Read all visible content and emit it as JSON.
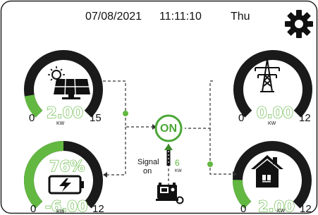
{
  "header": {
    "date": "07/08/2021",
    "time": "11:11:10",
    "day": "Thu"
  },
  "settings": {
    "icon": "gear-icon"
  },
  "pv": {
    "value": "2.00",
    "unit": "KW",
    "scale_min": "0",
    "scale_max": "15",
    "level": 0.13,
    "icon": "solar-panel-icon"
  },
  "grid": {
    "value": "0.00",
    "unit": "KW",
    "scale_min": "0",
    "scale_max": "12",
    "level": 0.0,
    "icon": "power-tower-icon"
  },
  "battery": {
    "percent": "76%",
    "value": "-6.00",
    "unit": "KW",
    "scale_min": "0",
    "scale_max": "12",
    "level": 0.5,
    "icon": "battery-charging-icon"
  },
  "load": {
    "value": "2.00",
    "unit": "KW",
    "scale_min": "0",
    "scale_max": "12",
    "level": 0.17,
    "icon": "house-icon"
  },
  "inverter": {
    "label": "ON"
  },
  "generator": {
    "signal_label_1": "Signal",
    "signal_label_2": "on",
    "value": "6",
    "unit": "KW",
    "icon": "generator-icon"
  },
  "colors": {
    "accent_green": "#62b841",
    "gauge_dark": "#1a1a1a",
    "background": "#ffffff"
  }
}
